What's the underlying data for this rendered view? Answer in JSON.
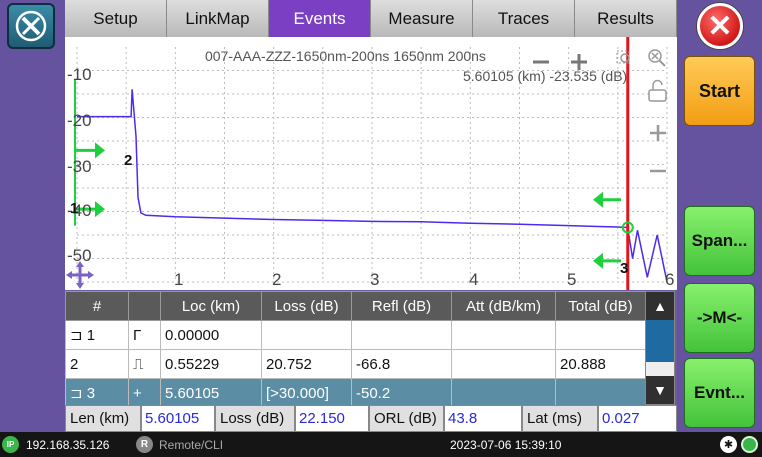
{
  "tabs": [
    "Setup",
    "LinkMap",
    "Events",
    "Measure",
    "Traces",
    "Results"
  ],
  "active_tab": "Events",
  "plot": {
    "title": "007-AAA-ZZZ-1650nm-200ns  1650nm 200ns",
    "cursor_readout": "5.60105 (km) -23.535 (dB)",
    "y_ticks": [
      "-10",
      "-20",
      "-30",
      "-40",
      "-50"
    ],
    "x_ticks": [
      "1",
      "2",
      "3",
      "4",
      "5",
      "6"
    ],
    "marker_labels": [
      "2",
      "1",
      "3"
    ],
    "toolbar": {
      "zoom_out": "—",
      "zoom_in": "+"
    },
    "vzoom_in": "+",
    "vzoom_out": "—",
    "trace_color": "#4a2cf0",
    "cursor_color": "#e0161a",
    "marker_arrow_color": "#1ecf3e"
  },
  "chart_data": {
    "type": "line",
    "xlabel": "",
    "ylabel": "",
    "xlim": [
      0,
      6
    ],
    "ylim": [
      -55,
      -5
    ],
    "series": [
      {
        "x": [
          0.0,
          0.55,
          0.56,
          0.6,
          0.62,
          0.65,
          0.7,
          0.8,
          1.0,
          1.5,
          2.0,
          2.5,
          3.0,
          3.5,
          4.0,
          4.5,
          5.0,
          5.3,
          5.5,
          5.6,
          5.65,
          5.7,
          5.8,
          5.9,
          6.0
        ],
        "y": [
          -19.8,
          -19.8,
          -14.0,
          -24.0,
          -37.0,
          -40.3,
          -40.8,
          -40.9,
          -41.1,
          -41.4,
          -41.7,
          -41.9,
          -42.1,
          -42.2,
          -42.5,
          -42.7,
          -43.0,
          -43.2,
          -43.3,
          -43.4,
          -50.0,
          -44.0,
          -54.0,
          -45.0,
          -55.0
        ]
      }
    ],
    "cursor_x": 5.60105
  },
  "table": {
    "headers": [
      "#",
      "",
      "Loc (km)",
      "Loss (dB)",
      "Refl (dB)",
      "Att (dB/km)",
      "Total (dB)"
    ],
    "rows": [
      {
        "num": "1",
        "type": "Γ",
        "loc": "0.00000",
        "loss": "",
        "refl": "",
        "att": "",
        "total": ""
      },
      {
        "num": "2",
        "type": "⎍",
        "loc": "0.55229",
        "loss": "20.752",
        "refl": "-66.8",
        "att": "",
        "total": "20.888"
      },
      {
        "num": "3",
        "type": "+",
        "loc": "5.60105",
        "loss": "[>30.000]",
        "refl": "-50.2",
        "att": "",
        "total": ""
      }
    ]
  },
  "summary": {
    "len_label": "Len (km)",
    "len_value": "5.60105",
    "loss_label": "Loss (dB)",
    "loss_value": "22.150",
    "orl_label": "ORL (dB)",
    "orl_value": "43.8",
    "lat_label": "Lat (ms)",
    "lat_value": "0.027"
  },
  "buttons": {
    "start": "Start",
    "span": "Span...",
    "marker": "->M<-",
    "event": "Evnt..."
  },
  "status": {
    "ip_badge": "IP",
    "ip": "192.168.35.126",
    "remote_badge": "R",
    "remote": "Remote/CLI",
    "datetime": "2023-07-06  15:39:10"
  }
}
